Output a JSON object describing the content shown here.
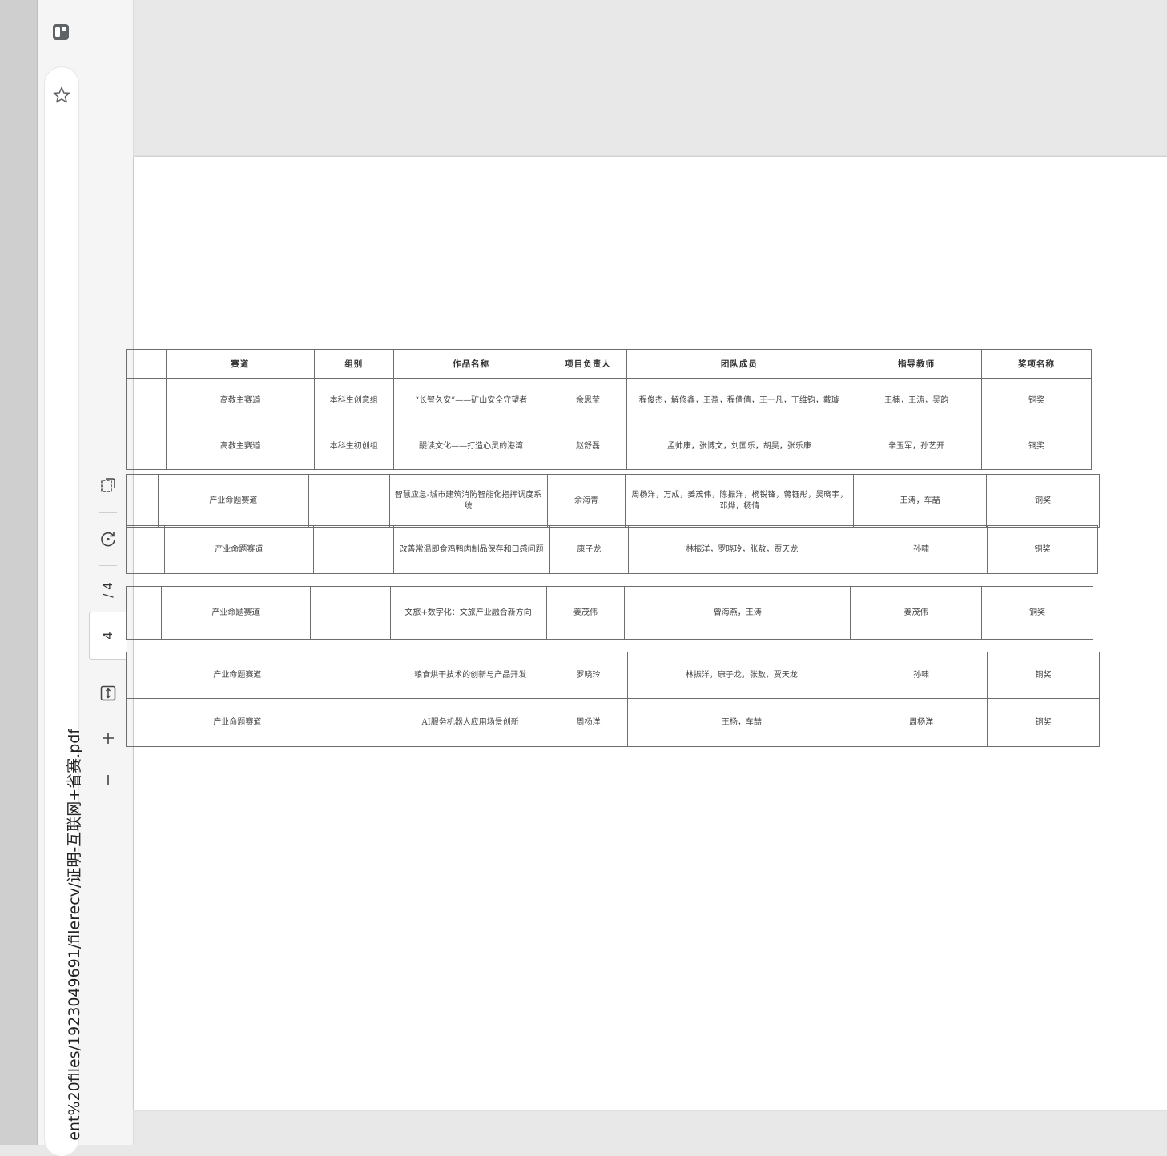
{
  "browser": {
    "url": "ent%20files/1923049691/filerecv/证明-互联网+省赛.pdf",
    "star_label": "Add to favorites",
    "tabs_label": "Tab actions"
  },
  "pdf_toolbar": {
    "current_page": "4",
    "total_pages": "/ 4",
    "zoom_in": "+",
    "zoom_out": "−"
  },
  "tables": [
    {
      "headers": [
        "",
        "赛道",
        "组别",
        "作品名称",
        "项目负责人",
        "团队成员",
        "指导教师",
        "奖项名称"
      ],
      "rows": [
        [
          "",
          "高教主赛道",
          "本科生创意组",
          "“长智久安”——矿山安全守望者",
          "余思莹",
          "程俊杰，解修鑫，王盈，程倩倩，王一凡，丁维钧，戴璇",
          "王楠，王涛，吴韵",
          "铜奖"
        ],
        [
          "",
          "高教主赛道",
          "本科生初创组",
          "醍读文化——打造心灵的港湾",
          "赵舒磊",
          "孟帅康，张博文，刘国乐，胡昊，张乐康",
          "辛玉军，孙艺开",
          "铜奖"
        ]
      ]
    },
    {
      "rows": [
        [
          "",
          "产业命题赛道",
          "",
          "智慧应急-城市建筑消防智能化指挥调度系统",
          "余海青",
          "周杨洋，万成，姜茂伟，陈振洋，杨锐锋，蒋钰彤，吴晓宇，邓烨，杨倩",
          "王涛，车喆",
          "铜奖"
        ]
      ]
    },
    {
      "rows": [
        [
          "",
          "产业命题赛道",
          "",
          "改善常温即食鸡鸭肉制品保存和口感问题",
          "康子龙",
          "林振洋，罗晓玲，张敖，贾天龙",
          "孙啸",
          "铜奖"
        ]
      ]
    },
    {
      "rows": [
        [
          "",
          "产业命题赛道",
          "",
          "文旅+数字化：文旅产业融合新方向",
          "姜茂伟",
          "曾海燕，王涛",
          "姜茂伟",
          "铜奖"
        ]
      ]
    },
    {
      "rows": [
        [
          "",
          "产业命题赛道",
          "",
          "粮食烘干技术的创新与产品开发",
          "罗晓玲",
          "林振洋，康子龙，张敖，贾天龙",
          "孙啸",
          "铜奖"
        ],
        [
          "",
          "产业命题赛道",
          "",
          "AI服务机器人应用场景创新",
          "周杨洋",
          "王杨，车喆",
          "周杨洋",
          "铜奖"
        ]
      ]
    }
  ]
}
